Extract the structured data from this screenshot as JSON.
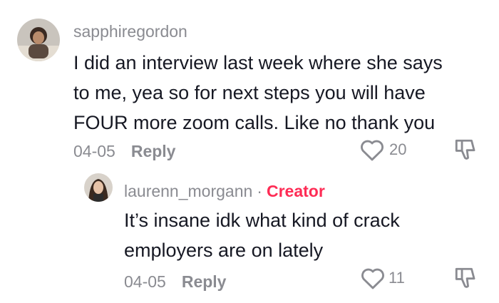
{
  "comments": [
    {
      "username": "sapphiregordon",
      "lines": [
        "I did an interview last week where she says",
        "to me, yea so for next steps you will have",
        "FOUR more zoom calls. Like no thank you"
      ],
      "date": "04-05",
      "reply_label": "Reply",
      "likes": "20",
      "like_icon": "heart-outline-icon",
      "dislike_icon": "thumbs-down-icon"
    }
  ],
  "replies": [
    {
      "username": "laurenn_morgann",
      "separator": "·",
      "badge": "Creator",
      "lines": [
        "It’s insane idk what kind of crack",
        "employers are on lately"
      ],
      "date": "04-05",
      "reply_label": "Reply",
      "likes": "11",
      "like_icon": "heart-outline-icon",
      "dislike_icon": "thumbs-down-icon"
    }
  ],
  "colors": {
    "text": "#161823",
    "muted": "#8a8b91",
    "creator": "#fe2c55"
  }
}
